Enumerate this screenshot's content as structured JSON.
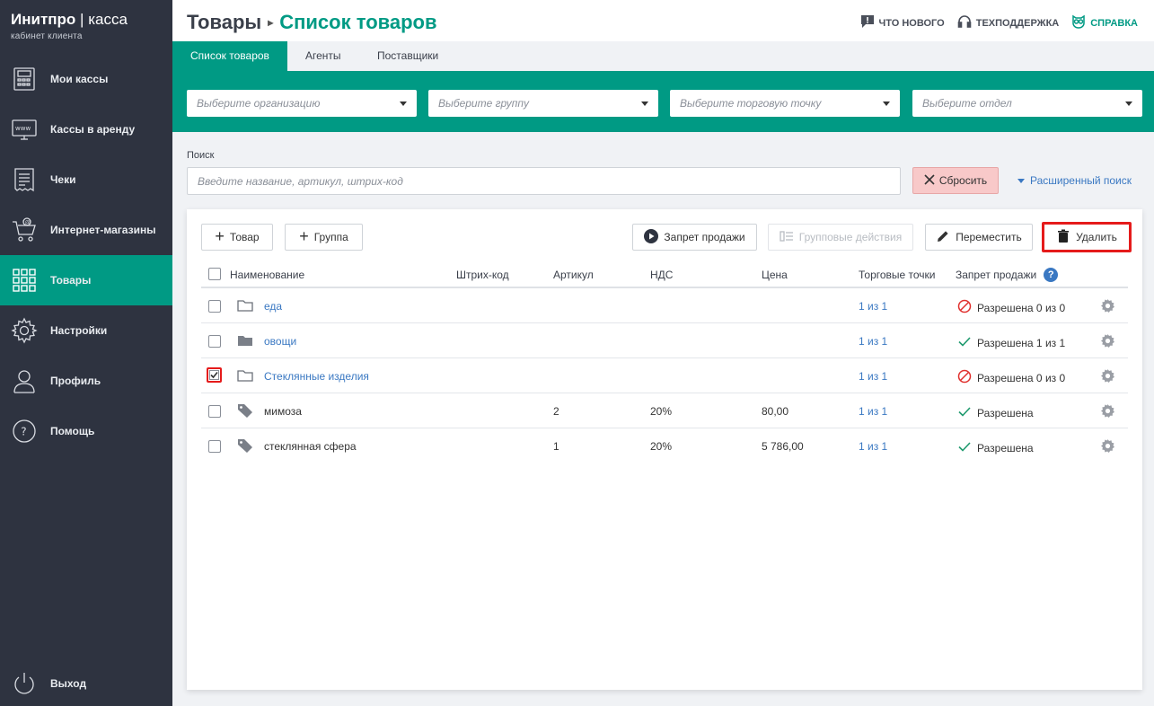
{
  "brand": {
    "name": "Инитпро",
    "divider": "|",
    "product": "касса",
    "subtitle": "кабинет клиента"
  },
  "sidebar": {
    "items": [
      {
        "label": "Мои кассы",
        "icon": "cash-register-icon"
      },
      {
        "label": "Кассы в аренду",
        "icon": "www-monitor-icon"
      },
      {
        "label": "Чеки",
        "icon": "receipt-icon"
      },
      {
        "label": "Интернет-магазины",
        "icon": "online-cart-icon"
      },
      {
        "label": "Товары",
        "icon": "grid-icon",
        "active": true
      },
      {
        "label": "Настройки",
        "icon": "gear-icon"
      },
      {
        "label": "Профиль",
        "icon": "user-icon"
      },
      {
        "label": "Помощь",
        "icon": "help-circle-icon"
      }
    ],
    "logout": {
      "label": "Выход",
      "icon": "power-icon"
    }
  },
  "header": {
    "title": "Товары",
    "separator": "▸",
    "crumb": "Список товаров",
    "links": [
      {
        "label": "ЧТО НОВОГО",
        "icon": "chat-alert-icon"
      },
      {
        "label": "ТЕХПОДДЕРЖКА",
        "icon": "headset-icon"
      },
      {
        "label": "СПРАВКА",
        "icon": "owl-icon"
      }
    ]
  },
  "tabs": [
    {
      "label": "Список товаров",
      "active": true
    },
    {
      "label": "Агенты"
    },
    {
      "label": "Поставщики"
    }
  ],
  "filters": [
    {
      "placeholder": "Выберите организацию"
    },
    {
      "placeholder": "Выберите группу"
    },
    {
      "placeholder": "Выберите торговую точку"
    },
    {
      "placeholder": "Выберите отдел"
    }
  ],
  "search": {
    "label": "Поиск",
    "placeholder": "Введите название, артикул, штрих-код",
    "value": "",
    "reset_label": "Сбросить",
    "advanced_label": "Расширенный поиск"
  },
  "toolbar": {
    "add_product": "Товар",
    "add_group": "Группа",
    "sale_ban": "Запрет продажи",
    "group_actions": "Групповые действия",
    "move": "Переместить",
    "delete": "Удалить"
  },
  "table": {
    "columns": [
      "Наименование",
      "Штрих-код",
      "Артикул",
      "НДС",
      "Цена",
      "Торговые точки",
      "Запрет продажи"
    ],
    "help_badge": "?",
    "rows": [
      {
        "type": "folder-open",
        "name": "еда",
        "barcode": "",
        "article": "",
        "vat": "",
        "price": "",
        "points": "1 из 1",
        "status": "Разрешена 0 из 0",
        "status_kind": "banned",
        "checked": false
      },
      {
        "type": "folder-filled",
        "name": "овощи",
        "barcode": "",
        "article": "",
        "vat": "",
        "price": "",
        "points": "1 из 1",
        "status": "Разрешена 1 из 1",
        "status_kind": "allowed",
        "checked": false
      },
      {
        "type": "folder-open",
        "name": "Стеклянные изделия",
        "barcode": "",
        "article": "",
        "vat": "",
        "price": "",
        "points": "1 из 1",
        "status": "Разрешена 0 из 0",
        "status_kind": "banned",
        "checked": true
      },
      {
        "type": "tag",
        "name": "мимоза",
        "barcode": "",
        "article": "2",
        "vat": "20%",
        "price": "80,00",
        "points": "1 из 1",
        "status": "Разрешена",
        "status_kind": "allowed",
        "checked": false
      },
      {
        "type": "tag",
        "name": "стеклянная сфера",
        "barcode": "",
        "article": "1",
        "vat": "20%",
        "price": "5 786,00",
        "points": "1 из 1",
        "status": "Разрешена",
        "status_kind": "allowed",
        "checked": false
      }
    ]
  },
  "colors": {
    "sidebar_bg": "#2e3340",
    "accent": "#009a84",
    "link": "#3a78c2",
    "danger": "#e51b1b",
    "reset_bg": "#f8c9c9"
  }
}
